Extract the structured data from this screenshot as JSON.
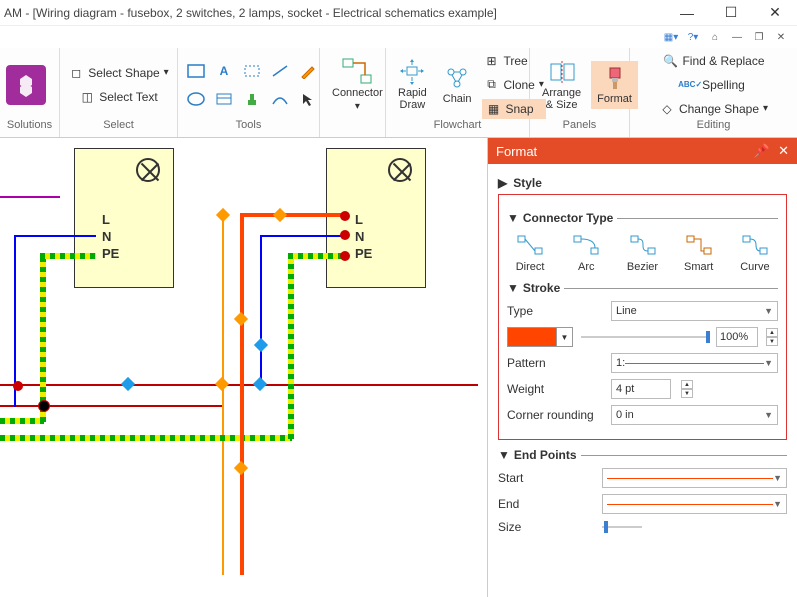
{
  "title": "AM - [Wiring diagram - fusebox, 2 switches, 2 lamps, socket - Electrical schematics example]",
  "ribbon": {
    "solutions_label": "Solutions",
    "select_shape": "Select Shape",
    "select_text": "Select Text",
    "group_select": "Select",
    "group_tools": "Tools",
    "connector": "Connector",
    "rapid_draw": "Rapid\nDraw",
    "chain": "Chain",
    "group_flowchart": "Flowchart",
    "tree": "Tree",
    "clone": "Clone",
    "snap": "Snap",
    "arrange": "Arrange\n& Size",
    "format": "Format",
    "group_panels": "Panels",
    "find_replace": "Find & Replace",
    "spelling": "Spelling",
    "change_shape": "Change Shape",
    "group_editing": "Editing"
  },
  "panel": {
    "title": "Format",
    "style": "Style",
    "connector_type": "Connector Type",
    "ct_direct": "Direct",
    "ct_arc": "Arc",
    "ct_bezier": "Bezier",
    "ct_smart": "Smart",
    "ct_curve": "Curve",
    "stroke": "Stroke",
    "type_label": "Type",
    "type_value": "Line",
    "opacity": "100%",
    "pattern_label": "Pattern",
    "pattern_value": "1:",
    "weight_label": "Weight",
    "weight_value": "4 pt",
    "corner_label": "Corner rounding",
    "corner_value": "0 in",
    "endpoints": "End Points",
    "start_label": "Start",
    "end_label": "End",
    "size_label": "Size"
  },
  "lamp_labels": [
    "L",
    "N",
    "PE"
  ]
}
